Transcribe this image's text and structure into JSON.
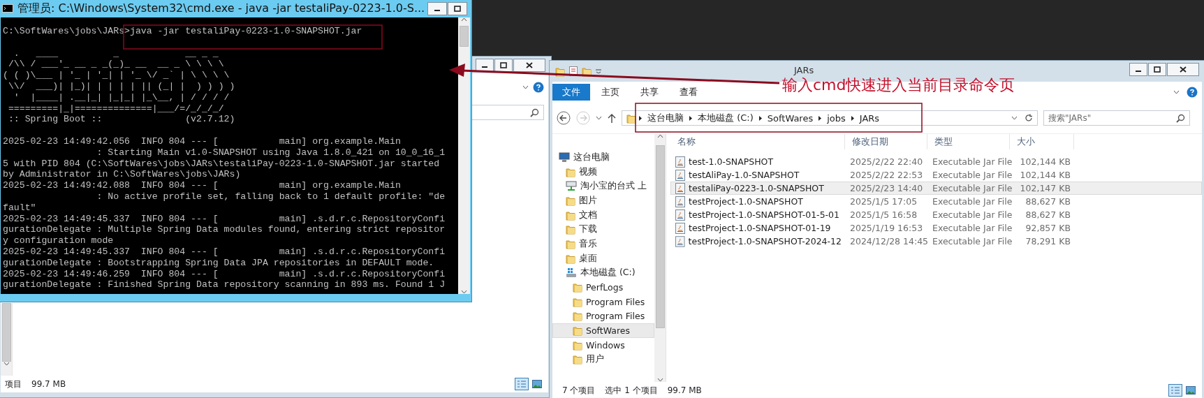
{
  "annotation": {
    "text": "输入cmd快速进入当前目录命令页"
  },
  "back_window": {
    "status_bar": {
      "item_count": "项目",
      "size": "99.7 MB"
    }
  },
  "cmd_window": {
    "title": "管理员: C:\\Windows\\System32\\cmd.exe - java  -jar testaliPay-0223-1.0-S...",
    "blocks": [
      [
        "C:\\SoftWares\\jobs\\JARs>java -jar testaliPay-0223-1.0-SNAPSHOT.jar"
      ],
      [
        "  .   ____          _            __ _ _",
        " /\\\\ / ___'_ __ _ _(_)_ __  __ _ \\ \\ \\ \\",
        "( ( )\\___ | '_ | '_| | '_ \\/ _` | \\ \\ \\ \\",
        " \\\\/  ___)| |_)| | | | | || (_| |  ) ) ) )",
        "  '  |____| .__|_| |_|_| |_\\__, | / / / /",
        " =========|_|==============|___/=/_/_/_/",
        " :: Spring Boot ::               (v2.7.12)"
      ],
      [
        "2025-02-23 14:49:42.056  INFO 804 --- [           main] org.example.Main",
        "                 : Starting Main v1.0-SNAPSHOT using Java 1.8.0_421 on 10_0_16_1",
        "5 with PID 804 (C:\\SoftWares\\jobs\\JARs\\testaliPay-0223-1.0-SNAPSHOT.jar started",
        "by Administrator in C:\\SoftWares\\jobs\\JARs)",
        "2025-02-23 14:49:42.088  INFO 804 --- [           main] org.example.Main",
        "                 : No active profile set, falling back to 1 default profile: \"de",
        "fault\"",
        "2025-02-23 14:49:45.337  INFO 804 --- [           main] .s.d.r.c.RepositoryConfi",
        "gurationDelegate : Multiple Spring Data modules found, entering strict repositor",
        "y configuration mode",
        "2025-02-23 14:49:45.337  INFO 804 --- [           main] .s.d.r.c.RepositoryConfi",
        "gurationDelegate : Bootstrapping Spring Data JPA repositories in DEFAULT mode.",
        "2025-02-23 14:49:46.259  INFO 804 --- [           main] .s.d.r.c.RepositoryConfi",
        "gurationDelegate : Finished Spring Data repository scanning in 893 ms. Found 1 J"
      ]
    ]
  },
  "explorer": {
    "title": "JARs",
    "ribbon_tabs": [
      {
        "label": "文件",
        "selected": true
      },
      {
        "label": "主页",
        "selected": false
      },
      {
        "label": "共享",
        "selected": false
      },
      {
        "label": "查看",
        "selected": false
      }
    ],
    "breadcrumbs": [
      "这台电脑",
      "本地磁盘 (C:)",
      "SoftWares",
      "jobs",
      "JARs"
    ],
    "search": {
      "placeholder": "搜索\"JARs\""
    },
    "nav_tree": [
      {
        "label": "这台电脑",
        "kind": "computer",
        "selected": false,
        "children": [
          {
            "label": "视频",
            "kind": "folder",
            "selected": false
          },
          {
            "label": "淘小宝的台式 上",
            "kind": "network",
            "selected": false
          },
          {
            "label": "图片",
            "kind": "folder",
            "selected": false
          },
          {
            "label": "文档",
            "kind": "folder",
            "selected": false
          },
          {
            "label": "下载",
            "kind": "folder",
            "selected": false
          },
          {
            "label": "音乐",
            "kind": "folder",
            "selected": false
          },
          {
            "label": "桌面",
            "kind": "folder",
            "selected": false
          },
          {
            "label": "本地磁盘 (C:)",
            "kind": "drive",
            "selected": false,
            "children": [
              {
                "label": "PerfLogs",
                "kind": "folder",
                "selected": false
              },
              {
                "label": "Program Files",
                "kind": "folder",
                "selected": false
              },
              {
                "label": "Program Files",
                "kind": "folder",
                "selected": false
              },
              {
                "label": "SoftWares",
                "kind": "folder",
                "selected": true
              },
              {
                "label": "Windows",
                "kind": "folder",
                "selected": false
              },
              {
                "label": "用户",
                "kind": "folder",
                "selected": false
              }
            ]
          }
        ]
      }
    ],
    "columns": [
      "名称",
      "修改日期",
      "类型",
      "大小"
    ],
    "files": [
      {
        "name": "test-1.0-SNAPSHOT",
        "modified": "2025/2/22 22:40",
        "type": "Executable Jar File",
        "size": "102,144 KB",
        "selected": false
      },
      {
        "name": "testAliPay-1.0-SNAPSHOT",
        "modified": "2025/2/22 22:53",
        "type": "Executable Jar File",
        "size": "102,144 KB",
        "selected": false
      },
      {
        "name": "testaliPay-0223-1.0-SNAPSHOT",
        "modified": "2025/2/23 14:40",
        "type": "Executable Jar File",
        "size": "102,147 KB",
        "selected": true
      },
      {
        "name": "testProject-1.0-SNAPSHOT",
        "modified": "2025/1/5 17:05",
        "type": "Executable Jar File",
        "size": "88,627 KB",
        "selected": false
      },
      {
        "name": "testProject-1.0-SNAPSHOT-01-5-01",
        "modified": "2025/1/5 16:58",
        "type": "Executable Jar File",
        "size": "88,627 KB",
        "selected": false
      },
      {
        "name": "testProject-1.0-SNAPSHOT-01-19",
        "modified": "2025/1/19 16:53",
        "type": "Executable Jar File",
        "size": "92,857 KB",
        "selected": false
      },
      {
        "name": "testProject-1.0-SNAPSHOT-2024-12",
        "modified": "2024/12/28 14:45",
        "type": "Executable Jar File",
        "size": "78,291 KB",
        "selected": false
      }
    ],
    "status_bar": {
      "item_count": "7 个项目",
      "selection": "选中 1 个项目",
      "size": "99.7 MB"
    }
  }
}
